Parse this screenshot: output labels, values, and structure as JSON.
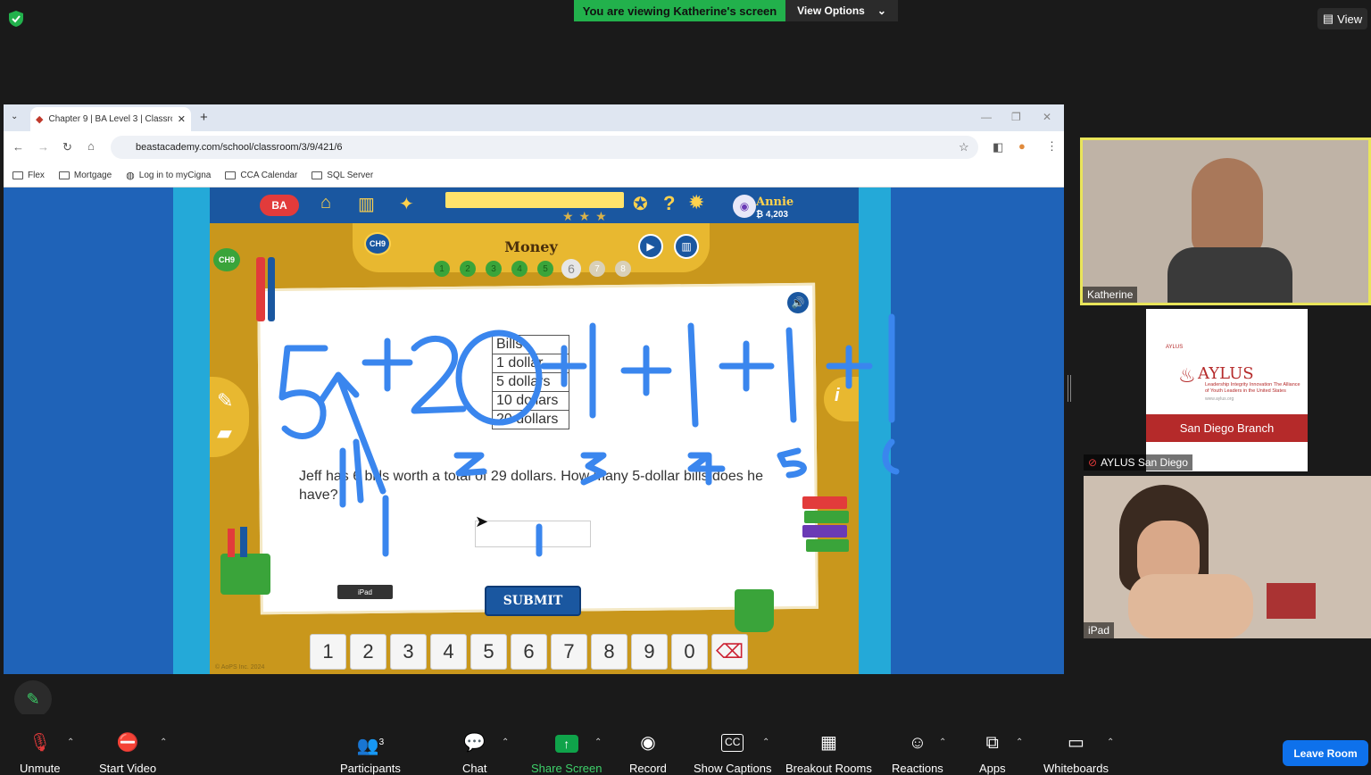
{
  "zoom": {
    "viewing_banner": "You are viewing Katherine's screen",
    "view_options": "View Options",
    "view_button": "View"
  },
  "browser": {
    "tab_title": "Chapter 9 | BA Level 3 | Classro",
    "url": "beastacademy.com/school/classroom/3/9/421/6",
    "bookmarks": [
      "Flex",
      "Mortgage",
      "Log in to myCigna",
      "CCA Calendar",
      "SQL Server"
    ]
  },
  "game": {
    "chapter_badge": "CH9",
    "lesson_title": "Money",
    "levels": [
      "1",
      "2",
      "3",
      "4",
      "5",
      "6",
      "7",
      "8"
    ],
    "user_name": "Annie",
    "user_coins": "₿ 4,203",
    "bill_table": [
      "Bills",
      "1 dollar",
      "5 dollars",
      "10 dollars",
      "20 dollars"
    ],
    "question": "Jeff has 6 bills worth a total of 29 dollars. How many 5-dollar bills does he have?",
    "answer_value": "",
    "submit_label": "SUBMIT",
    "keypad": [
      "1",
      "2",
      "3",
      "4",
      "5",
      "6",
      "7",
      "8",
      "9",
      "0"
    ],
    "ipad_tag": "iPad",
    "copyright": "© AoPS Inc. 2024",
    "annotation_marks": [
      "1",
      "2",
      "3",
      "4",
      "5",
      "6",
      "1"
    ]
  },
  "participants": [
    {
      "name": "Katherine"
    },
    {
      "name": "AYLUS San Diego",
      "card_title": "AYLUS",
      "card_top": "AYLUS",
      "card_sub": "Leadership Integrity Innovation The Alliance of Youth Leaders in the United States",
      "card_url": "www.aylus.org",
      "branch": "San Diego Branch"
    },
    {
      "name": "iPad"
    }
  ],
  "controls": {
    "unmute": "Unmute",
    "start_video": "Start Video",
    "participants": "Participants",
    "participants_count": "3",
    "chat": "Chat",
    "share_screen": "Share Screen",
    "record": "Record",
    "show_captions": "Show Captions",
    "breakout_rooms": "Breakout Rooms",
    "reactions": "Reactions",
    "apps": "Apps",
    "whiteboards": "Whiteboards",
    "leave_room": "Leave Room"
  },
  "colors": {
    "banner_green": "#22b14c",
    "leave_blue": "#0e71eb",
    "annotation_blue": "#3a86ee",
    "speaker_highlight": "#e9e55a"
  }
}
